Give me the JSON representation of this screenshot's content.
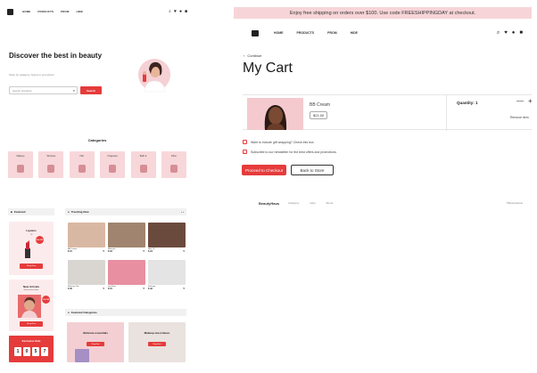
{
  "left": {
    "nav": {
      "items": [
        "HOME",
        "PRODUCTS",
        "PROM",
        "HIDE"
      ],
      "icons": [
        "search-icon",
        "heart-icon",
        "user-icon",
        "bag-icon"
      ]
    },
    "hero": {
      "title": "Discover the best in beauty",
      "subtitle": "Shop by category, brand or promotion!",
      "search_placeholder": "search products",
      "search_button": "Search"
    },
    "categories": {
      "title": "Categories",
      "items": [
        "Makeup",
        "Skincare",
        "Hair",
        "Fragrance",
        "Bath &",
        "Other"
      ]
    },
    "featured": {
      "title": "Featured",
      "cards": [
        {
          "title": "Lipstics",
          "subtitle": "7U",
          "badge": "20% OFF",
          "button": "Shop Now"
        },
        {
          "title": "New Arrivals",
          "subtitle": "Discover the latest",
          "badge": "15% OFF",
          "button": "Shop Now"
        }
      ],
      "deal": {
        "title": "Exclusive Sale",
        "digits": [
          "1",
          "0",
          "5",
          "7"
        ]
      }
    },
    "trending": {
      "title": "Trending Now",
      "arrows": "‹ ›",
      "products": [
        {
          "name": "BB Cream",
          "price": "$ 21",
          "swatch": "#d9b8a3"
        },
        {
          "name": "Mascara",
          "price": "$ 18",
          "swatch": "#a0846f"
        },
        {
          "name": "Hair Oil",
          "price": "$ 24",
          "swatch": "#6b4a3e"
        },
        {
          "name": "Skincare Set",
          "price": "$ 35",
          "swatch": "#d9d6d2"
        },
        {
          "name": "Lip Gloss",
          "price": "$ 15",
          "swatch": "#e88fa1"
        },
        {
          "name": "Perfume",
          "price": "$ 42",
          "swatch": "#e4e4e4"
        }
      ]
    },
    "featured_categories": {
      "title": "Featured Categories",
      "cards": [
        {
          "title": "Skincare essentials",
          "button": "Shop Now"
        },
        {
          "title": "Makeup must-haves",
          "button": "Shop Now"
        }
      ]
    }
  },
  "right": {
    "promo": "Enjoy free shipping on orders over $100. Use code FREESHIPPINGDAY at checkout.",
    "nav": {
      "items": [
        "HOME",
        "PRODUCTS",
        "PROM",
        "HIDE"
      ],
      "icons": [
        "search-icon",
        "heart-icon",
        "user-icon",
        "bag-icon"
      ]
    },
    "breadcrumb": "Continue",
    "title": "My Cart",
    "item": {
      "name": "BB Cream",
      "price": "$21.00",
      "quantity_label": "Quantity: 1",
      "minus": "—",
      "plus": "+",
      "remove": "Remove item"
    },
    "options": [
      "Want to include gift wrapping? Check this box.",
      "Subscribe to our newsletter for the best offers and promotions."
    ],
    "buttons": {
      "checkout": "Proceed to Checkout",
      "store": "Back to Store"
    },
    "footer": {
      "brand": "BeautyHaus",
      "links": [
        "Category",
        "Help",
        "About"
      ],
      "copyright": "©BeautyHaus"
    }
  },
  "colors": {
    "accent": "#e63b3b",
    "pink": "#f7d4d8"
  }
}
